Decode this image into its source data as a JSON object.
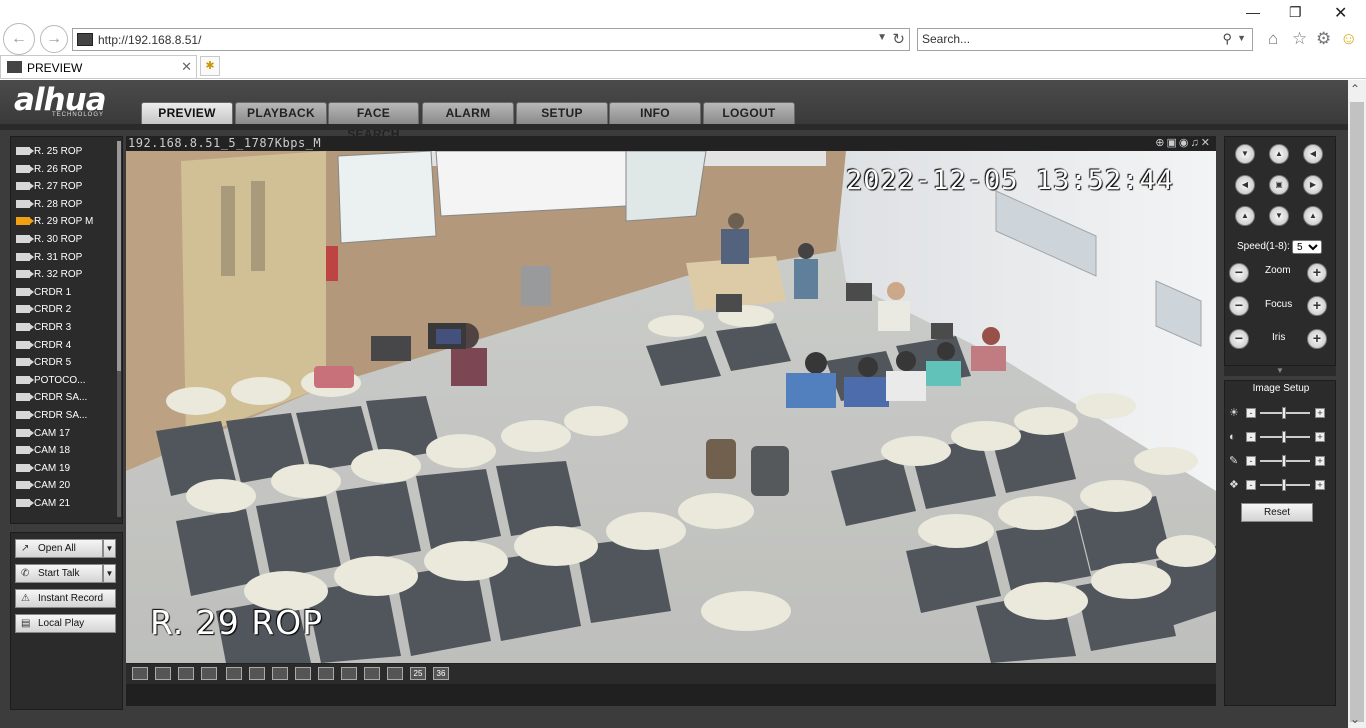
{
  "browser": {
    "url": "http://192.168.8.51/",
    "search_placeholder": "Search...",
    "tab_title": "PREVIEW"
  },
  "brand": {
    "logo": "alhua",
    "tagline": "TECHNOLOGY"
  },
  "nav": {
    "tabs": [
      {
        "label": "PREVIEW",
        "active": true
      },
      {
        "label": "PLAYBACK"
      },
      {
        "label": "FACE SEARCH"
      },
      {
        "label": "ALARM"
      },
      {
        "label": "SETUP"
      },
      {
        "label": "INFO"
      },
      {
        "label": "LOGOUT"
      }
    ]
  },
  "cameras": [
    "R. 25 ROP",
    "R. 26 ROP",
    "R. 27 ROP",
    "R. 28 ROP",
    "R. 29 ROP   M",
    "R. 30 ROP",
    "R. 31 ROP",
    "R. 32 ROP",
    "CRDR 1",
    "CRDR 2",
    "CRDR 3",
    "CRDR 4",
    "CRDR 5",
    "POTOCO...",
    "CRDR SA...",
    "CRDR SA...",
    "CAM 17",
    "CAM 18",
    "CAM 19",
    "CAM 20",
    "CAM 21"
  ],
  "active_camera_index": 4,
  "controls": {
    "open_all": "Open All",
    "start_talk": "Start Talk",
    "instant_record": "Instant Record",
    "local_play": "Local Play"
  },
  "video": {
    "stream_title": "192.168.8.51_5_1787Kbps_M",
    "osd_time": "2022-12-05 13:52:44",
    "osd_name": "R. 29 ROP"
  },
  "ptz": {
    "speed_label": "Speed(1-8):",
    "speed_value": "5",
    "zoom_label": "Zoom",
    "focus_label": "Focus",
    "iris_label": "Iris"
  },
  "image_setup": {
    "title": "Image Setup",
    "reset": "Reset"
  },
  "layout_labels": {
    "l25": "25",
    "l36": "36"
  },
  "colors": {
    "active_camera": "#f0a010",
    "panel_bg": "#2b2b2b",
    "page_bg": "#3c3c3c"
  }
}
